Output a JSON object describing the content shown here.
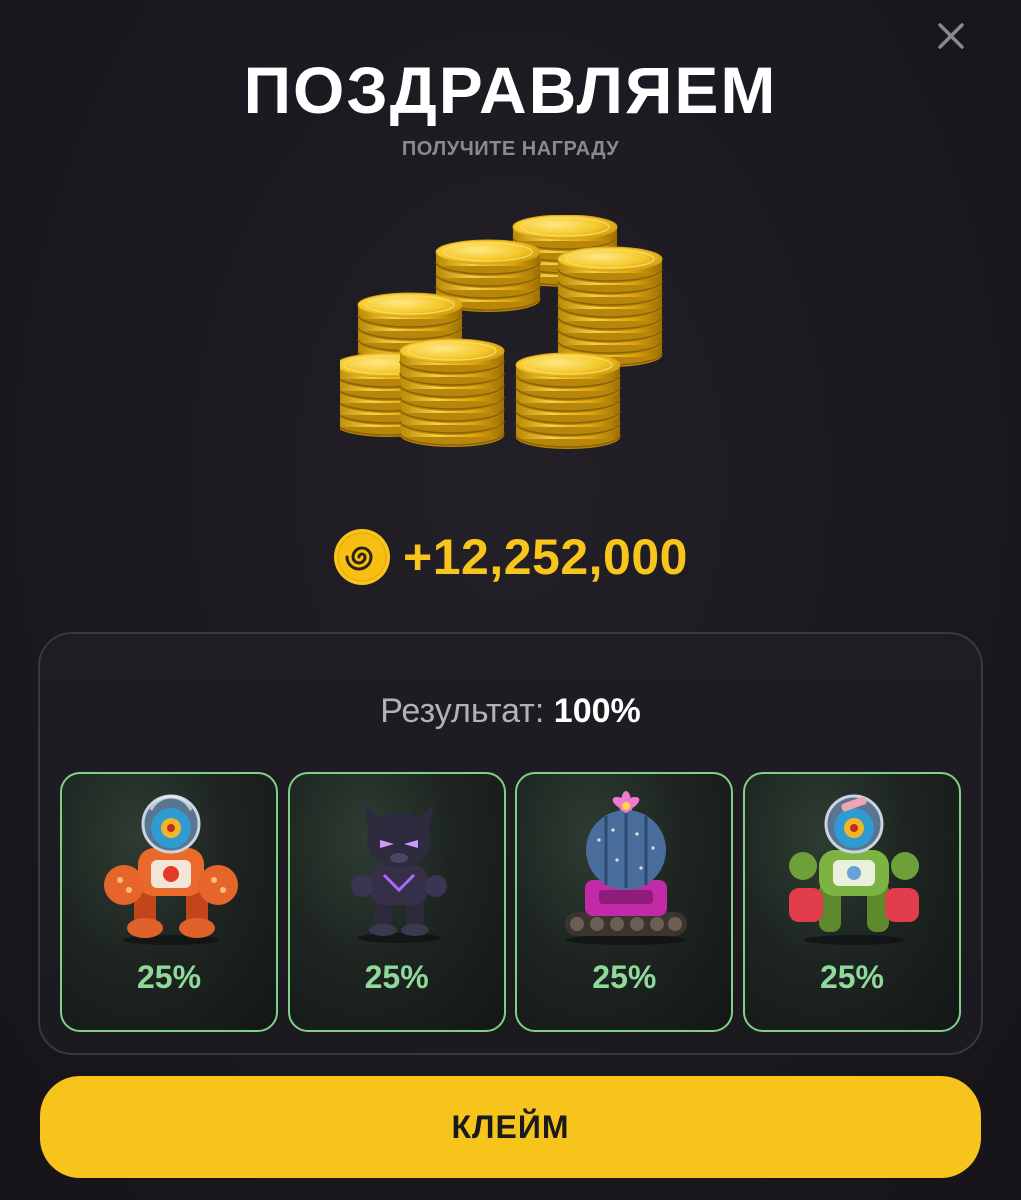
{
  "header": {
    "title": "ПОЗДРАВЛЯЕМ",
    "subtitle": "ПОЛУЧИТЕ НАГРАДУ",
    "close_icon": "close-icon"
  },
  "reward": {
    "art": "gold-coins-stack-image",
    "currency_icon": "spiral-token-icon",
    "amount": "+12,252,000"
  },
  "result": {
    "label": "Результат:",
    "value": "100%",
    "cards": [
      {
        "character": "orange-astronaut-robot",
        "percent": "25%"
      },
      {
        "character": "purple-panther-robot",
        "percent": "25%"
      },
      {
        "character": "cactus-tank",
        "percent": "25%"
      },
      {
        "character": "green-astronaut-robot",
        "percent": "25%"
      }
    ]
  },
  "actions": {
    "claim_label": "КЛЕЙМ"
  },
  "colors": {
    "background": "#1b191f",
    "accent_gold": "#f8c51c",
    "button": "#f7c41b",
    "card_border": "#7fcf86",
    "percent_text": "#8fd99a"
  }
}
